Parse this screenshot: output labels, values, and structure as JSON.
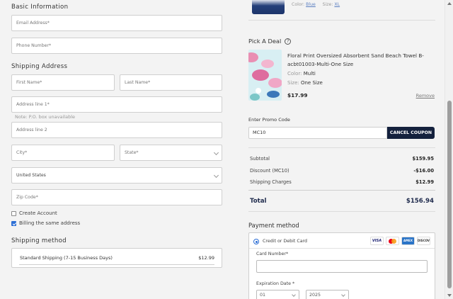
{
  "basic": {
    "title": "Basic Information",
    "email_placeholder": "Email Address*",
    "phone_placeholder": "Phone Number*"
  },
  "shipping_address": {
    "title": "Shipping Address",
    "first_name": "First Name*",
    "last_name": "Last Name*",
    "address1": "Address line 1*",
    "note": "Note: P.O. box unavailable",
    "address2": "Address line 2",
    "city": "City*",
    "state": "State*",
    "country": "United States",
    "zip": "Zip Code*"
  },
  "options": {
    "create_account": "Create Account",
    "billing_same": "Billing the same address"
  },
  "shipping_method": {
    "title": "Shipping method",
    "option_label": "Standard Shipping (7-15 Business Days)",
    "option_price": "$12.99"
  },
  "top_item": {
    "color_label": "Color:",
    "color_value": "Blue",
    "size_label": "Size:",
    "size_value": "XL"
  },
  "deal": {
    "title": "Pick A Deal",
    "help_icon": "?",
    "product_name": "Floral Print Oversized Absorbent Sand Beach Towel B-acbt01003-Multi-One Size",
    "color_label": "Color:",
    "color_value": "Multi",
    "size_label": "Size:",
    "size_value": "One Size",
    "price": "$17.99",
    "remove_label": "Remove"
  },
  "promo": {
    "label": "Enter Promo Code",
    "value": "MC10",
    "button": "CANCEL COUPON"
  },
  "summary": {
    "subtotal_label": "Subtotal",
    "subtotal": "$159.95",
    "discount_label": "Discount (MC10)",
    "discount": "-$16.00",
    "shipping_label": "Shipping Charges",
    "shipping": "$12.99",
    "total_label": "Total",
    "total": "$156.94"
  },
  "payment": {
    "title": "Payment method",
    "option": "Credit or Debit Card",
    "cards": [
      "VISA",
      "Mastercard",
      "AMEX",
      "DISCOVER"
    ],
    "card_number_label": "Card Number*",
    "expiration_label": "Expiration Date *",
    "month": "01",
    "year": "2025"
  },
  "colors": {
    "accent": "#14213d",
    "link": "#5b7fc0",
    "check": "#2c6ed5"
  }
}
